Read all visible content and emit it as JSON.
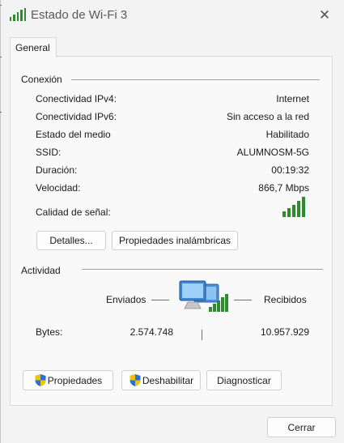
{
  "window": {
    "title": "Estado de Wi-Fi 3",
    "close_glyph": "✕"
  },
  "tabs": [
    {
      "label": "General",
      "active": true
    }
  ],
  "connection": {
    "heading": "Conexión",
    "rows": [
      {
        "label": "Conectividad IPv4:",
        "value": "Internet"
      },
      {
        "label": "Conectividad IPv6:",
        "value": "Sin acceso a la red"
      },
      {
        "label": "Estado del medio",
        "value": "Habilitado"
      },
      {
        "label": "SSID:",
        "value": "ALUMNOSM-5G"
      },
      {
        "label": "Duración:",
        "value": "00:19:32"
      },
      {
        "label": "Velocidad:",
        "value": "866,7 Mbps"
      }
    ],
    "signal_label": "Calidad de señal:",
    "signal_bars_active": 5,
    "signal_bars_total": 5,
    "buttons": {
      "details": "Detalles...",
      "wireless_props": "Propiedades inalámbricas"
    }
  },
  "activity": {
    "heading": "Actividad",
    "sent_label": "Enviados",
    "received_label": "Recibidos",
    "bytes_label": "Bytes:",
    "bytes_sent": "2.574.748",
    "bytes_received": "10.957.929"
  },
  "actions": {
    "properties": "Propiedades",
    "disable": "Deshabilitar",
    "diagnose": "Diagnosticar"
  },
  "footer": {
    "close": "Cerrar"
  },
  "colors": {
    "signal_green": "#2e8b2e",
    "window_bg": "#f3f3f3",
    "panel_bg": "#f9f9f9"
  },
  "icons": {
    "title": "wifi-signal-icon",
    "network": "network-computers-icon",
    "shield": "uac-shield-icon"
  }
}
